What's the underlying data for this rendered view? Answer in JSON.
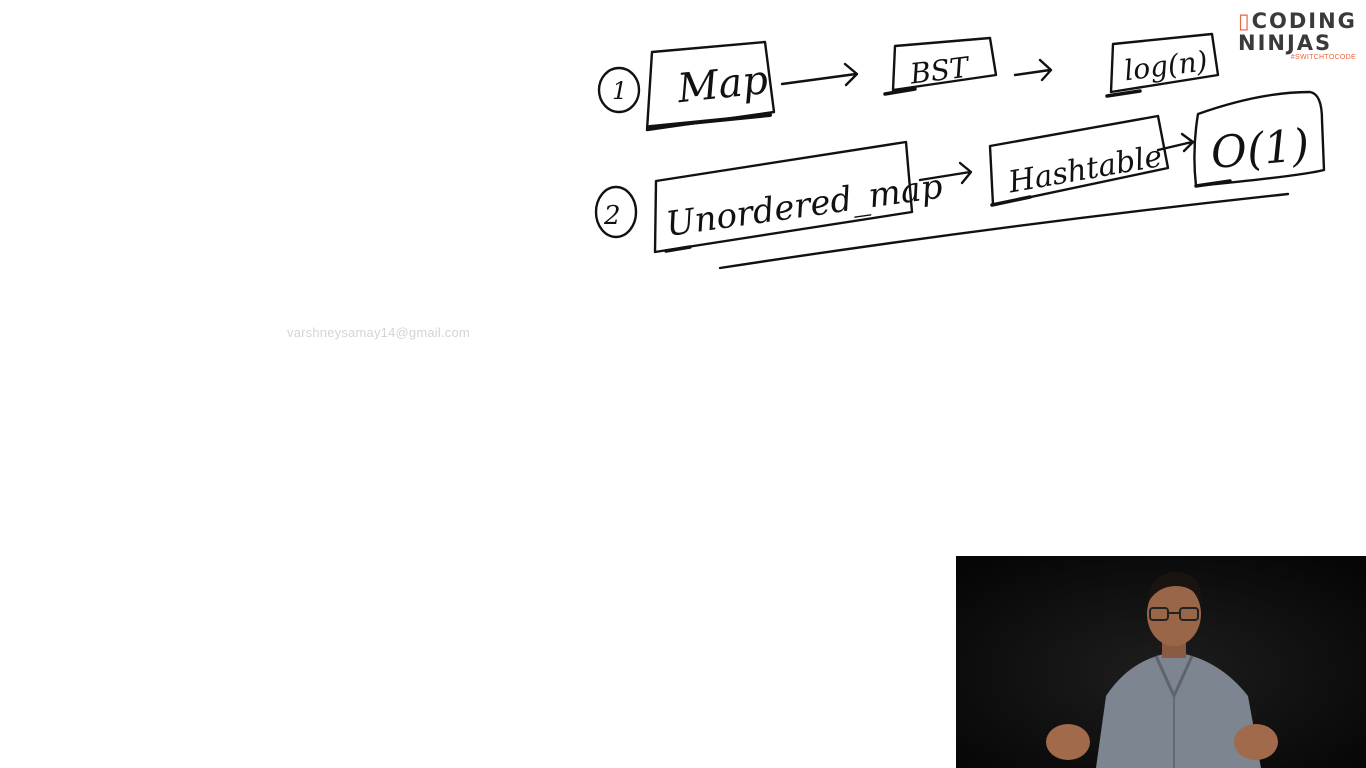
{
  "diagram": {
    "row1": {
      "number": "1",
      "nodes": [
        "Map",
        "BST",
        "log(n)"
      ]
    },
    "row2": {
      "number": "2",
      "nodes": [
        "Unordered_map",
        "Hashtable",
        "O(1)"
      ]
    }
  },
  "watermark": "varshneysamay14@gmail.com",
  "logo": {
    "line1": "CODING",
    "line2": "NINJAS",
    "tagline": "#SWITCHTOCODE",
    "accent_color": "#e8663d"
  },
  "video": {
    "description_icon": "presenter-video-icon"
  }
}
